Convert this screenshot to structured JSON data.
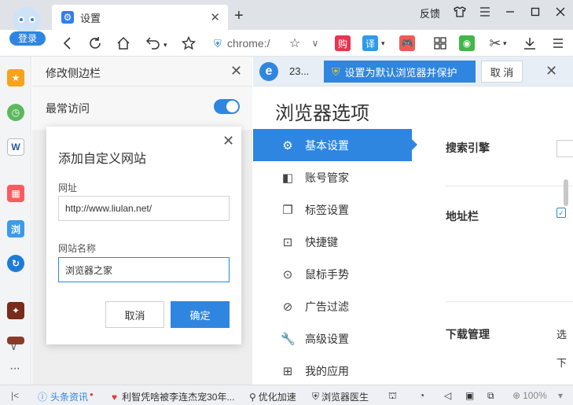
{
  "window": {
    "tab_title": "设置",
    "feedback": "反馈",
    "login_button": "登录"
  },
  "toolbar": {
    "address_text": "chrome:/"
  },
  "side_panel": {
    "title": "修改侧边栏",
    "frequent_label": "最常访问",
    "frequent_on": true
  },
  "dialog": {
    "title": "添加自定义网站",
    "url_label": "网址",
    "url_value": "http://www.liulan.net/",
    "name_label": "网站名称",
    "name_value": "浏览器之家",
    "cancel_label": "取消",
    "ok_label": "确定"
  },
  "notice": {
    "tab_count": "23...",
    "default_button": "设置为默认浏览器并保护",
    "cancel_button": "取 消"
  },
  "options": {
    "title": "浏览器选项",
    "nav": [
      {
        "label": "基本设置",
        "icon": "gear-icon",
        "active": true
      },
      {
        "label": "账号管家",
        "icon": "account-icon",
        "active": false
      },
      {
        "label": "标签设置",
        "icon": "tabs-icon",
        "active": false
      },
      {
        "label": "快捷键",
        "icon": "shortcut-icon",
        "active": false
      },
      {
        "label": "鼠标手势",
        "icon": "mouse-icon",
        "active": false
      },
      {
        "label": "广告过滤",
        "icon": "block-icon",
        "active": false
      },
      {
        "label": "高级设置",
        "icon": "wrench-icon",
        "active": false
      },
      {
        "label": "我的应用",
        "icon": "apps-icon",
        "active": false
      }
    ],
    "sections": {
      "search_engine": "搜索引擎",
      "address_bar": "地址栏",
      "download": "下载管理",
      "download_side_1": "选",
      "download_side_2": "下"
    }
  },
  "status": {
    "news": "头条资讯",
    "headline": "利智凭啥被李连杰宠30年...",
    "optimize": "优化加速",
    "doctor": "浏览器医生",
    "zoom": "100%"
  },
  "colors": {
    "accent": "#2f86e0",
    "tabstrip": "#dfe3e8",
    "panel_bg": "#eeeeee"
  }
}
